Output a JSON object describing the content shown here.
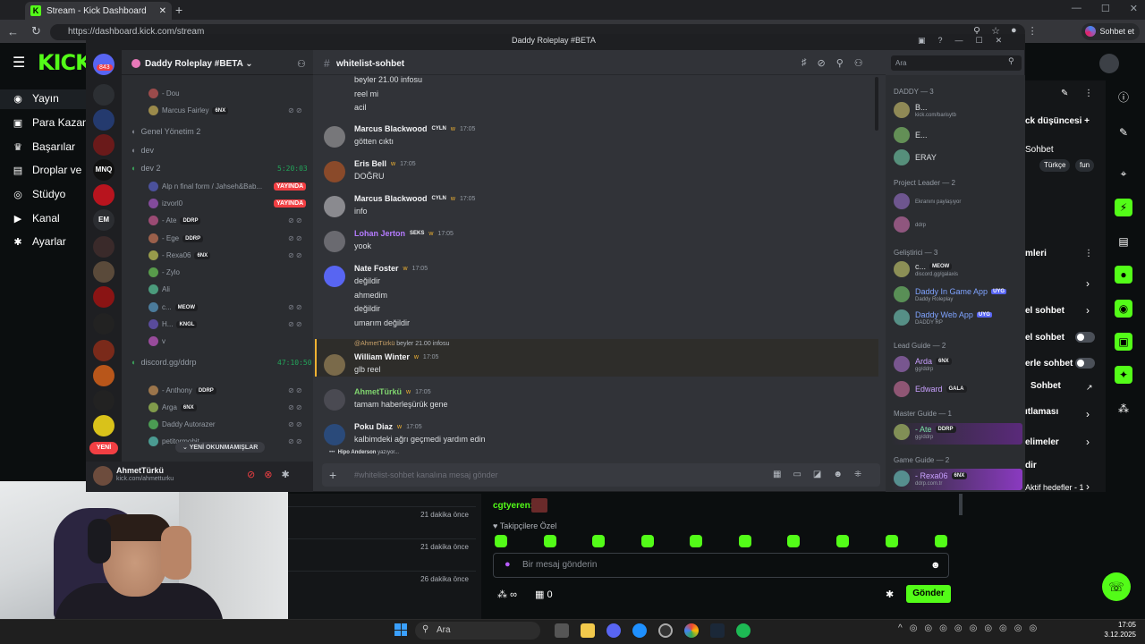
{
  "browser": {
    "tab_title": "Stream - Kick Dashboard",
    "url": "https://dashboard.kick.com/stream",
    "copilot_label": "Sohbet et"
  },
  "kick": {
    "logo": "KICK",
    "menu": [
      {
        "icon": "broadcast-icon",
        "glyph": "◉",
        "label": "Yayın"
      },
      {
        "icon": "money-icon",
        "glyph": "▣",
        "label": "Para Kazan"
      },
      {
        "icon": "trophy-icon",
        "glyph": "♛",
        "label": "Başarılar"
      },
      {
        "icon": "drops-icon",
        "glyph": "▤",
        "label": "Droplar ve"
      },
      {
        "icon": "studio-icon",
        "glyph": "◎",
        "label": "Stüdyo"
      },
      {
        "icon": "channel-icon",
        "glyph": "▶",
        "label": "Kanal"
      },
      {
        "icon": "settings-icon",
        "glyph": "✱",
        "label": "Ayarlar"
      }
    ],
    "right_panel": {
      "title_fragment": "ck düşüncesi +",
      "chat_label": "Sohbet",
      "chips": [
        "Türkçe",
        "fun"
      ],
      "section": "mleri",
      "rows": [
        "el sohbet",
        "el sohbet",
        "erle sohbet",
        "Sohbet",
        "ıtlaması",
        "elimeler",
        "dir",
        "Aktif hedefler - 1"
      ]
    },
    "recent_rows": [
      "21 dakika önce",
      "21 dakika önce",
      "26 dakika önce"
    ],
    "chat": {
      "username": "cgtyeren:",
      "followers_label": "Takipçilere Özel",
      "placeholder": "Bir mesaj gönderin",
      "infinity": "∞",
      "gift_count": "0",
      "send_label": "Gönder"
    }
  },
  "taskbar": {
    "search": "Ara",
    "time": "17:05",
    "date": "3.12.2025"
  },
  "discord": {
    "window_title": "Daddy Roleplay #BETA",
    "server_badge": "843",
    "server_abbrevs": [
      "MNQ",
      "EM"
    ],
    "yeni": "YENİ",
    "server_name": "Daddy Roleplay #BETA",
    "voice": [
      {
        "type": "user",
        "name": "- Dou"
      },
      {
        "type": "user",
        "name": "Marcus Fairley",
        "tag": "6NX"
      },
      {
        "type": "channel",
        "name": "Genel Yönetim 2"
      },
      {
        "type": "channel",
        "name": "dev"
      },
      {
        "type": "channel",
        "name": "dev 2",
        "timer": "5:20:03",
        "active": true
      },
      {
        "type": "user",
        "name": "Alp n final form / Jahseh&Bab...",
        "live": "YAYINDA"
      },
      {
        "type": "user",
        "name": "izvorl0",
        "live": "YAYINDA"
      },
      {
        "type": "user",
        "name": "- Ate",
        "tag": "DDRP"
      },
      {
        "type": "user",
        "name": "- Ege",
        "tag": "DDRP"
      },
      {
        "type": "user",
        "name": "- Rexa06",
        "tag": "6NX"
      },
      {
        "type": "user",
        "name": "- Zylo"
      },
      {
        "type": "user",
        "name": "Ali"
      },
      {
        "type": "user",
        "name": "c...",
        "tag": "MEOW"
      },
      {
        "type": "user",
        "name": "H...",
        "tag": "KNGL"
      },
      {
        "type": "user",
        "name": "v"
      },
      {
        "type": "channel",
        "name": "discord.gg/ddrp",
        "timer": "47:10:50",
        "active": true
      },
      {
        "type": "user",
        "name": "- Anthony",
        "tag": "DDRP"
      },
      {
        "type": "user",
        "name": "Arga",
        "tag": "6NX"
      },
      {
        "type": "user",
        "name": "Daddy Autorazer"
      },
      {
        "type": "user",
        "name": "petitormobit"
      }
    ],
    "new_unread": "YENİ OKUNMAMIŞLAR",
    "me": {
      "name": "AhmetTürkü",
      "status": "kick.com/ahmetturku"
    },
    "channel": "whitelist-sohbet",
    "search_placeholder": "Ara",
    "messages": [
      {
        "author": "",
        "time": "",
        "lines": [
          "beyler 21.00 infosu",
          "reel mi",
          "acil"
        ]
      },
      {
        "author": "Marcus Blackwood",
        "badge": "CYLN",
        "time": "17:05",
        "lines": [
          "götten cıktı"
        ]
      },
      {
        "author": "Eris Bell",
        "time": "17:05",
        "lines": [
          "DOĞRU"
        ]
      },
      {
        "author": "Marcus Blackwood",
        "badge": "CYLN",
        "time": "17:05",
        "lines": [
          "info"
        ]
      },
      {
        "author": "Lohan Jerton",
        "badge": "SEKS",
        "time": "17:05",
        "lines": [
          "yook"
        ]
      },
      {
        "author": "Nate Foster",
        "time": "17:05",
        "lines": [
          "değildir",
          "ahmedim",
          "değildir",
          "umarım değildir"
        ]
      },
      {
        "author": "William Winter",
        "time": "17:05",
        "reply_to": "@AhmetTürkü",
        "reply_text": "beyler 21.00 infosu",
        "lines": [
          "glb reel"
        ]
      },
      {
        "author": "AhmetTürkü",
        "time": "17:05",
        "lines": [
          "tamam haberleşürük gene"
        ]
      },
      {
        "author": "Poku Diaz",
        "time": "17:05",
        "lines": [
          "kalbimdeki ağrı geçmedi yardım edin"
        ]
      }
    ],
    "typing": {
      "who": "Hipo Anderson",
      "suffix": "yazıyor..."
    },
    "input_placeholder": "#whitelist-sohbet kanalına mesaj gönder",
    "members": [
      {
        "group": "DADDY — 3"
      },
      {
        "name": "B...",
        "sub": "kick.com/barisytb"
      },
      {
        "name": "E..."
      },
      {
        "name": "ERAY"
      },
      {
        "group": "Project Leader — 2"
      },
      {
        "name": "",
        "sub": "Ekranını paylaşıyor"
      },
      {
        "name": "",
        "sub": "ddrp"
      },
      {
        "group": "Geliştirici — 3"
      },
      {
        "name": "c...",
        "tag": "MEOW",
        "sub": "discord.gg/galaxis"
      },
      {
        "name": "Daddy In Game App",
        "app": "UYG",
        "sub": "Daddy Roleplay",
        "color": "#7fa3ff"
      },
      {
        "name": "Daddy Web App",
        "app": "UYG",
        "sub": "DADDY RP",
        "color": "#7fa3ff"
      },
      {
        "group": "Lead Guide — 2"
      },
      {
        "name": "Arda",
        "tag": "6NX",
        "sub": "gg/ddrp",
        "color": "#c9a0ff"
      },
      {
        "name": "Edward",
        "tag": "GALA",
        "color": "#c9a0ff"
      },
      {
        "group": "Master Guide — 1"
      },
      {
        "name": "- Ate",
        "tag": "DDRP",
        "sub": "gg/ddrp",
        "color": "#79e0a6"
      },
      {
        "group": "Game Guide — 2"
      },
      {
        "name": "- Rexa06",
        "tag": "6NX",
        "sub": "ddrp.com.tr",
        "color": "#c9a0ff"
      }
    ]
  },
  "colors": {
    "kick_green": "#53fc18",
    "discord_bg": "#313338",
    "live_red": "#f23f43"
  }
}
